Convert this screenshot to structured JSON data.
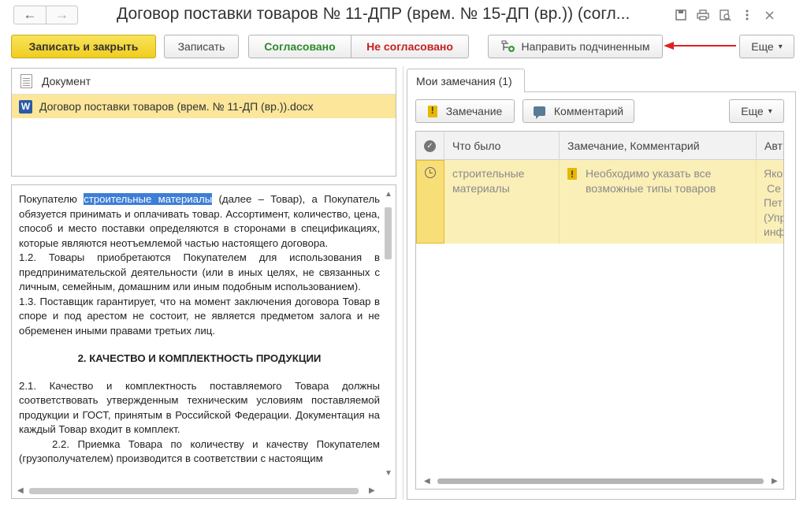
{
  "window": {
    "title": "Договор поставки товаров  № 11-ДПР (врем. № 15-ДП (вр.)) (согл...",
    "nav_back": "←",
    "nav_forward": "→",
    "icons": [
      "save-icon",
      "print-icon",
      "preview-icon",
      "more-vert-icon",
      "close-icon"
    ]
  },
  "toolbar": {
    "save_close": "Записать и закрыть",
    "save": "Записать",
    "approved": "Согласовано",
    "not_approved": "Не согласовано",
    "send_subordinates": "Направить подчиненным",
    "more": "Еще",
    "more_arrow": "▾"
  },
  "documents": {
    "header": "Документ",
    "file_icon_letter": "W",
    "file": "Договор поставки товаров (врем. № 11-ДП (вр.)).docx"
  },
  "doc_text": {
    "p1_before": "Покупателю ",
    "p1_highlight": "строительные материалы",
    "p1_after": " (далее – Товар), а Покупатель обязуется принимать и оплачивать товар. Ассортимент, количество, цена, способ и место поставки определяются в сторонами в спецификациях, которые являются неотъемлемой частью настоящего договора.",
    "p2": "1.2. Товары приобретаются Покупателем для использования в предпринимательской деятельности (или в иных целях, не связанных с личным, семейным, домашним или иным подобным использованием).",
    "p3": "1.3. Поставщик гарантирует, что на момент заключения договора Товар в споре и под арестом не состоит, не является предметом залога и не обременен иными правами третьих лиц.",
    "heading": "2. КАЧЕСТВО И КОМПЛЕКТНОСТЬ ПРОДУКЦИИ",
    "p4": "2.1. Качество и комплектность поставляемого Товара должны соответствовать утвержденным техническим условиям поставляемой продукции и ГОСТ, принятым в Российской Федерации. Документация на каждый Товар входит в комплект.",
    "p5": "2.2. Приемка Товара по количеству и качеству Покупателем (грузополучателем) производится в соответствии с настоящим"
  },
  "remarks": {
    "tab": "Мои замечания (1)",
    "remark_button": "Замечание",
    "comment_button": "Комментарий",
    "more": "Еще",
    "more_arrow": "▾",
    "columns": {
      "was": "Что было",
      "remark": "Замечание, Комментарий",
      "author": "Авт"
    },
    "row": {
      "was": "строительные материалы",
      "remark": "Необходимо указать все возможные типы товаров",
      "author_lines": [
        "Яко",
        "Се",
        "Пет",
        "(Упр",
        "инф"
      ]
    }
  },
  "colors": {
    "primary_button": "#f0cd1f",
    "approved": "#2b8a2b",
    "not_approved": "#c62020",
    "selection": "#fbe69a",
    "highlight": "#3d7ed6",
    "arrow": "#e02020"
  }
}
